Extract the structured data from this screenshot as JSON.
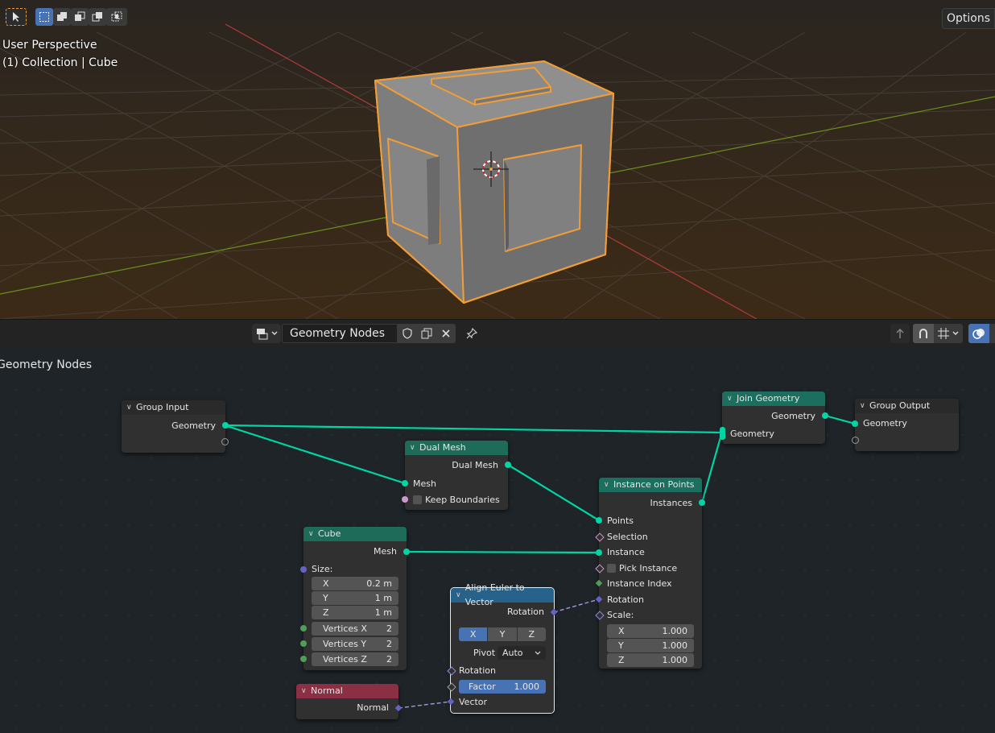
{
  "viewport": {
    "perspective_label": "User Perspective",
    "collection_label": "(1) Collection | Cube",
    "options_label": "Options",
    "select_color": "#f29d36"
  },
  "header": {
    "editor_type_icon": "node-editor-icon",
    "node_group_name": "Geometry Nodes",
    "icons": [
      "fake-user-shield-icon",
      "duplicate-icon",
      "close-icon",
      "pin-icon",
      "parent-arrow-icon",
      "snap-icon",
      "snap-grid-icon",
      "overlay-icon"
    ]
  },
  "editor": {
    "breadcrumb": "Geometry Nodes"
  },
  "nodes": {
    "group_input": {
      "title": "Group Input",
      "out_geometry": "Geometry"
    },
    "dual_mesh": {
      "title": "Dual Mesh",
      "out_dual_mesh": "Dual Mesh",
      "in_mesh": "Mesh",
      "keep_boundaries": "Keep Boundaries"
    },
    "join_geometry": {
      "title": "Join Geometry",
      "out_geometry": "Geometry",
      "in_geometry": "Geometry"
    },
    "group_output": {
      "title": "Group Output",
      "in_geometry": "Geometry"
    },
    "instance_on_points": {
      "title": "Instance on Points",
      "out_instances": "Instances",
      "points": "Points",
      "selection": "Selection",
      "instance": "Instance",
      "pick_instance": "Pick Instance",
      "instance_index": "Instance Index",
      "rotation": "Rotation",
      "scale": "Scale:",
      "scale_x_label": "X",
      "scale_x": "1.000",
      "scale_y_label": "Y",
      "scale_y": "1.000",
      "scale_z_label": "Z",
      "scale_z": "1.000"
    },
    "cube": {
      "title": "Cube",
      "out_mesh": "Mesh",
      "size": "Size:",
      "x_label": "X",
      "x": "0.2 m",
      "y_label": "Y",
      "y": "1 m",
      "z_label": "Z",
      "z": "1 m",
      "vx_label": "Vertices X",
      "vx": "2",
      "vy_label": "Vertices Y",
      "vy": "2",
      "vz_label": "Vertices Z",
      "vz": "2"
    },
    "align_euler": {
      "title": "Align Euler to Vector",
      "out_rotation": "Rotation",
      "axis_x": "X",
      "axis_y": "Y",
      "axis_z": "Z",
      "pivot_label": "Pivot",
      "pivot_value": "Auto",
      "in_rotation": "Rotation",
      "factor_label": "Factor",
      "factor_value": "1.000",
      "in_vector": "Vector"
    },
    "normal": {
      "title": "Normal",
      "out_normal": "Normal"
    }
  },
  "colors": {
    "geometry_socket": "#00d6a3",
    "vector_socket": "#6363c7",
    "header_geometry": "#1e6b5a",
    "header_vector": "#26628a",
    "header_input": "#8a2f44"
  }
}
